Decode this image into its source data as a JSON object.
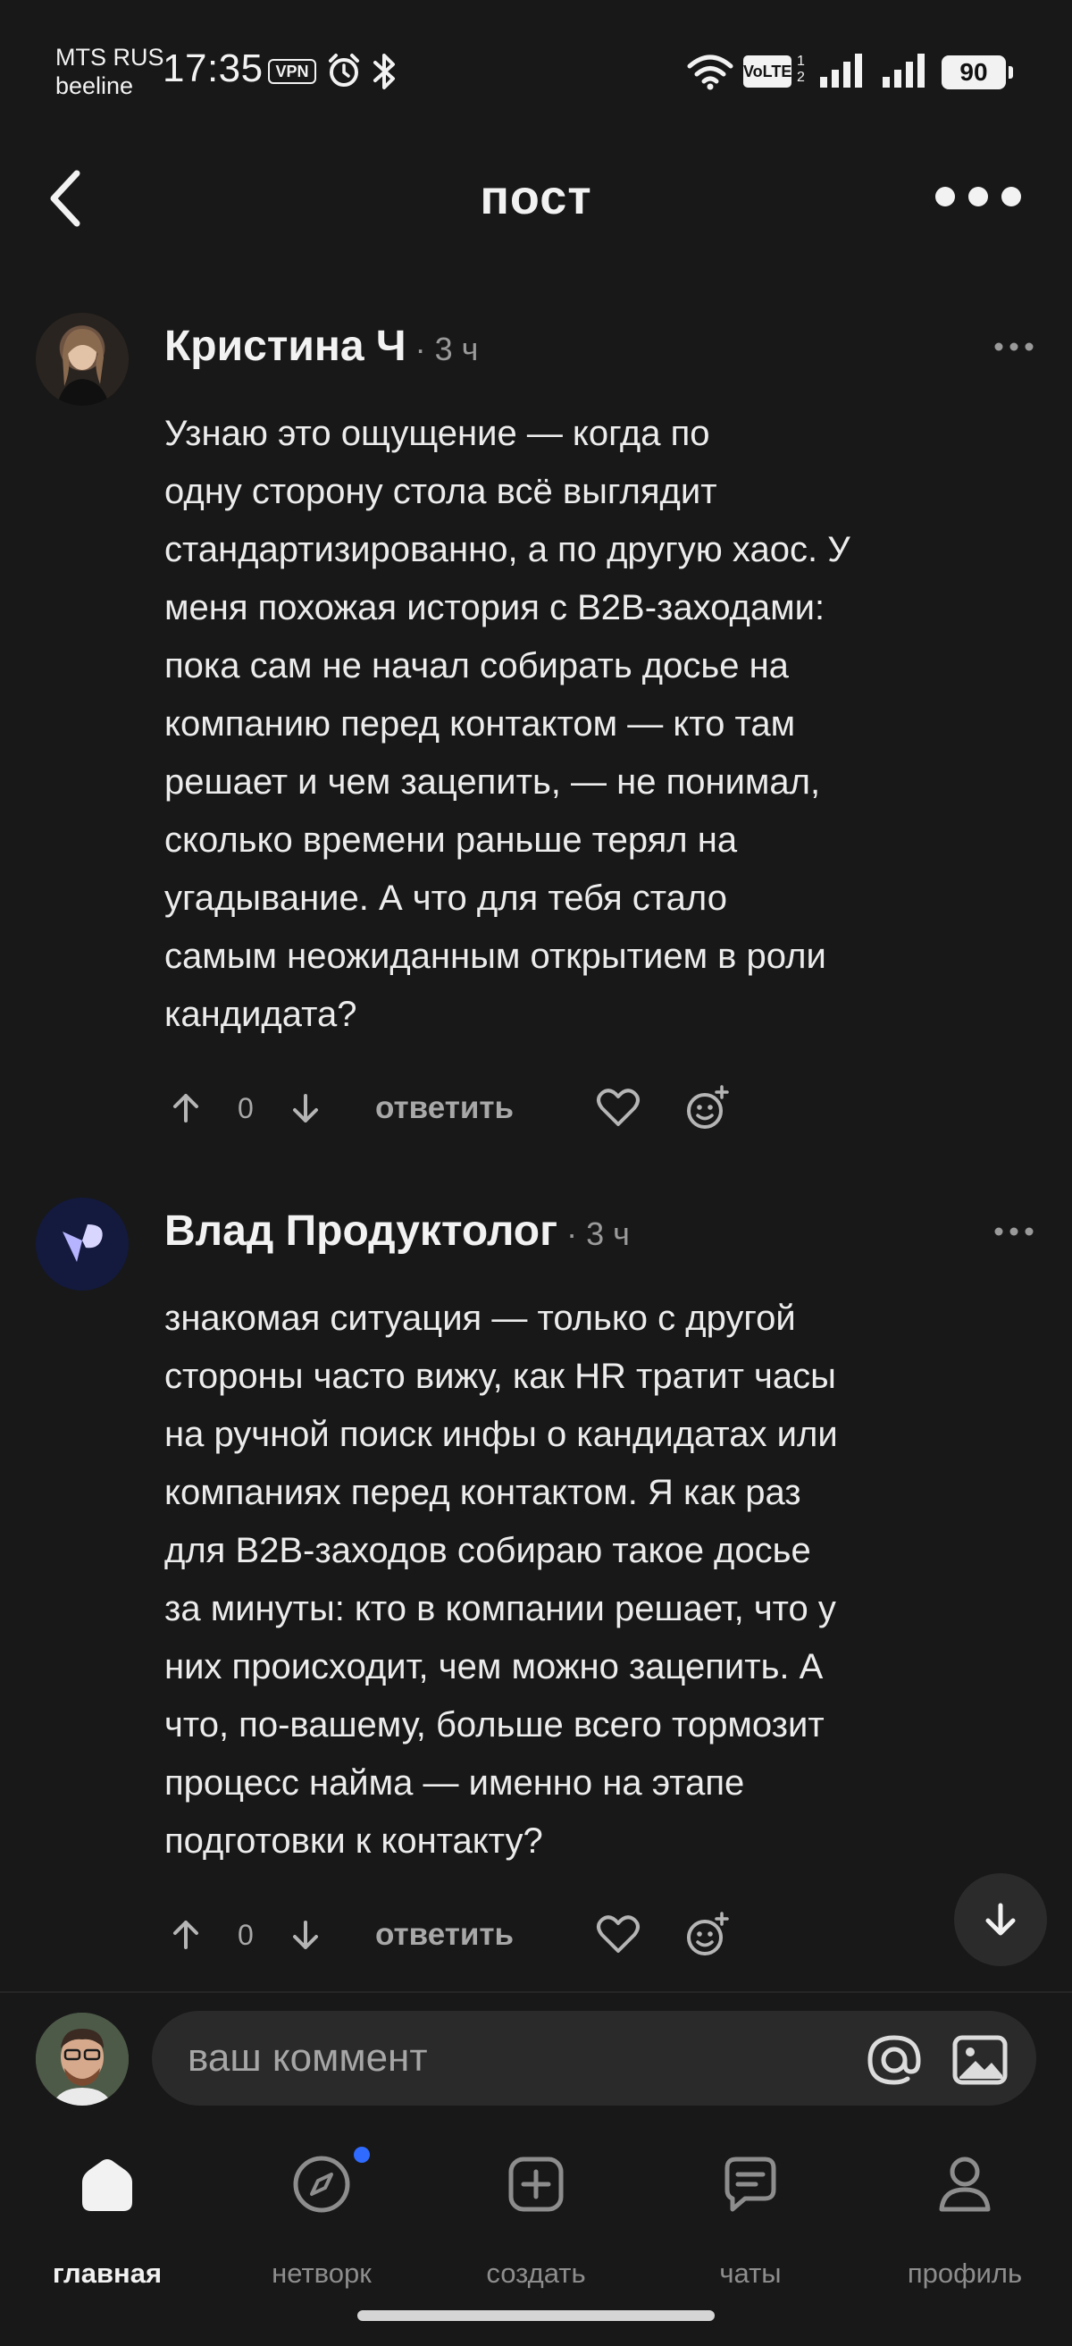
{
  "status_bar": {
    "carrier_1": "MTS RUS",
    "carrier_2": "beeline",
    "time": "17:35",
    "vpn_label": "VPN",
    "volte_label": "VoLTE",
    "volte_sub": "1\n2",
    "battery": "90"
  },
  "header": {
    "title": "пост"
  },
  "comments": [
    {
      "author": "Кристина Ч",
      "separator": " · ",
      "time": "3 ч",
      "text": "Узнаю это ощущение — когда по\nодну сторону стола всё выглядит\nстандартизированно, а по другую хаос. У\nменя похожая история с B2B-заходами:\nпока сам не начал собирать досье на\nкомпанию перед контактом — кто там\nрешает и чем зацепить, — не понимал,\nсколько времени раньше терял на\nугадывание. А что для тебя стало\nсамым неожиданным открытием в роли\nкандидата?",
      "votes": "0",
      "reply_label": "ответить"
    },
    {
      "author": "Влад Продуктолог",
      "separator": " · ",
      "time": "3 ч",
      "text": "знакомая ситуация — только с другой\nстороны часто вижу, как HR тратит часы\nна ручной поиск инфы о кандидатах или\nкомпаниях перед контактом. Я как раз\nдля B2B-заходов собираю такое досье\nза минуты: кто в компании решает, что у\nних происходит, чем можно зацепить. А\nчто, по-вашему, больше всего тормозит\nпроцесс найма — именно на этапе\nподготовки к контакту?",
      "votes": "0",
      "reply_label": "ответить"
    }
  ],
  "comment_input": {
    "placeholder": "ваш коммент"
  },
  "nav": {
    "items": [
      {
        "label": "главная",
        "icon": "home-icon",
        "active": true
      },
      {
        "label": "нетворк",
        "icon": "compass-icon",
        "badge": true
      },
      {
        "label": "создать",
        "icon": "plus-square-icon"
      },
      {
        "label": "чаты",
        "icon": "chat-icon"
      },
      {
        "label": "профиль",
        "icon": "user-icon"
      }
    ]
  },
  "colors": {
    "background": "#181818",
    "text": "#ececec",
    "muted": "#9a9a9a",
    "badge": "#2f6bff"
  }
}
